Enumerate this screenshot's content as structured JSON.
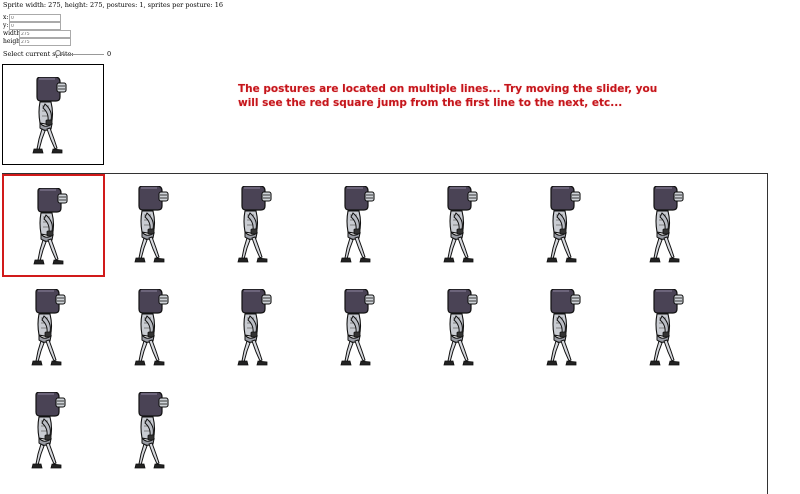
{
  "info_text": "Sprite width: 275, height: 275, postures: 1, sprites per posture: 16",
  "fields": [
    {
      "label": "x:",
      "value": "0"
    },
    {
      "label": "y:",
      "value": "0"
    },
    {
      "label": "width:",
      "value": "275"
    },
    {
      "label": "height:",
      "value": "275"
    }
  ],
  "slider": {
    "label": "Select current sprite:",
    "value": "0",
    "min": "0",
    "max": "15"
  },
  "message": "The postures are located on multiple lines... Try moving the slider, you will see the red square jump from the first line to the next, etc...",
  "sprites": {
    "count": 16,
    "selected_index": 0
  },
  "colors": {
    "selection": "#d11a1a",
    "message": "#c4161c"
  },
  "icons": {
    "sprite": "robot-walking-icon"
  }
}
